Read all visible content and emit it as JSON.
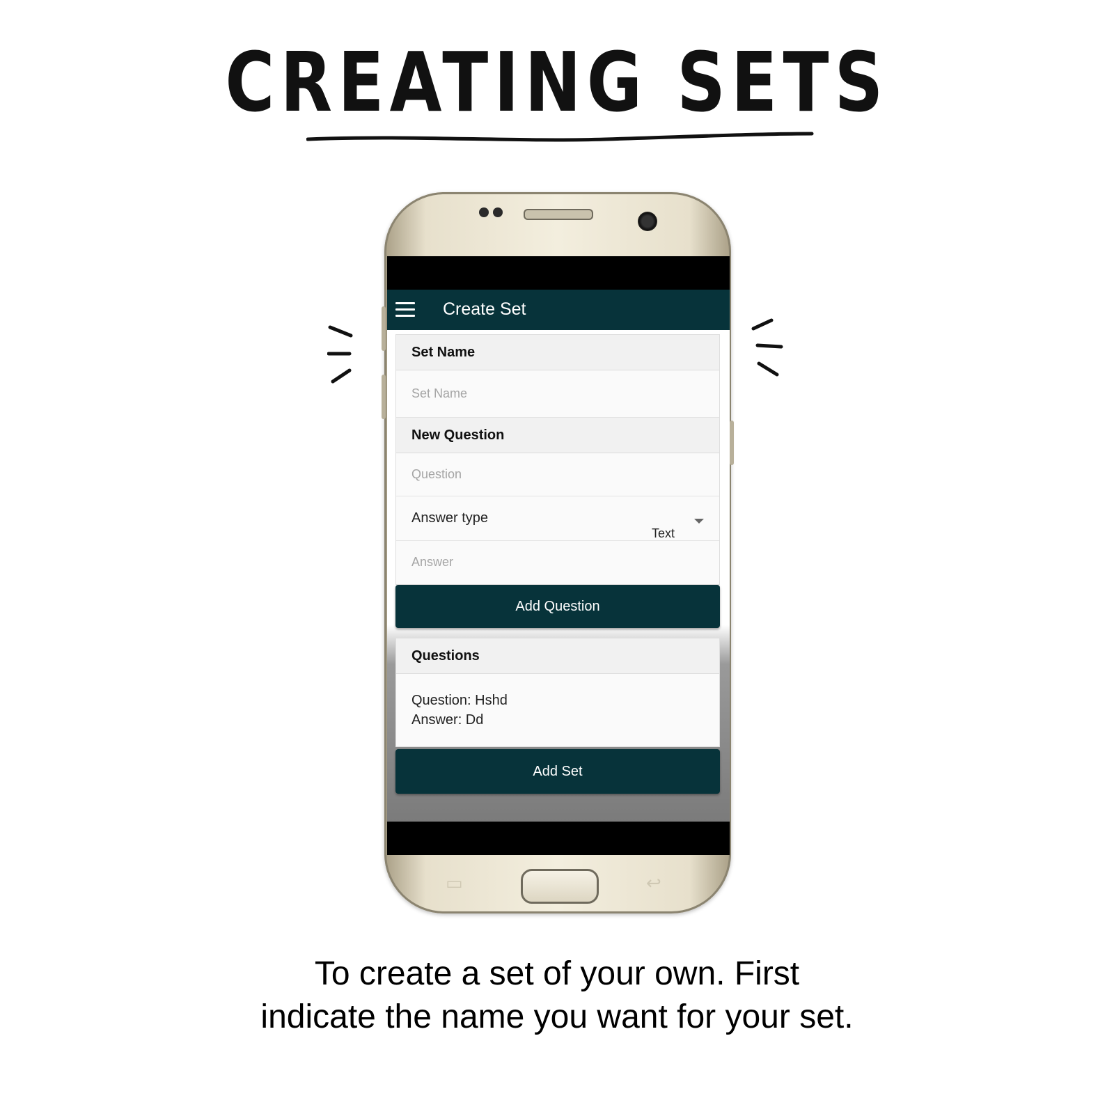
{
  "headline": "CREATING SETS",
  "app": {
    "title": "Create Set",
    "set_name_section": {
      "header": "Set Name",
      "input_placeholder": "Set Name"
    },
    "new_question_section": {
      "header": "New Question",
      "question_placeholder": "Question",
      "answer_type_label": "Answer type",
      "answer_type_value": "Text",
      "answer_placeholder": "Answer"
    },
    "add_question_label": "Add Question",
    "questions_section": {
      "header": "Questions",
      "items": [
        {
          "question": "Question: Hshd",
          "answer": "Answer: Dd"
        }
      ]
    },
    "add_set_label": "Add Set"
  },
  "caption": {
    "line1": "To create a set of your own. First",
    "line2": "indicate the name you want for your set."
  },
  "colors": {
    "app_bar": "#07333a",
    "button": "#07333a",
    "phone_body": "#e7e0cc"
  },
  "icons": [
    "menu-icon",
    "chevron-down-icon",
    "recent-apps-icon",
    "back-icon"
  ]
}
